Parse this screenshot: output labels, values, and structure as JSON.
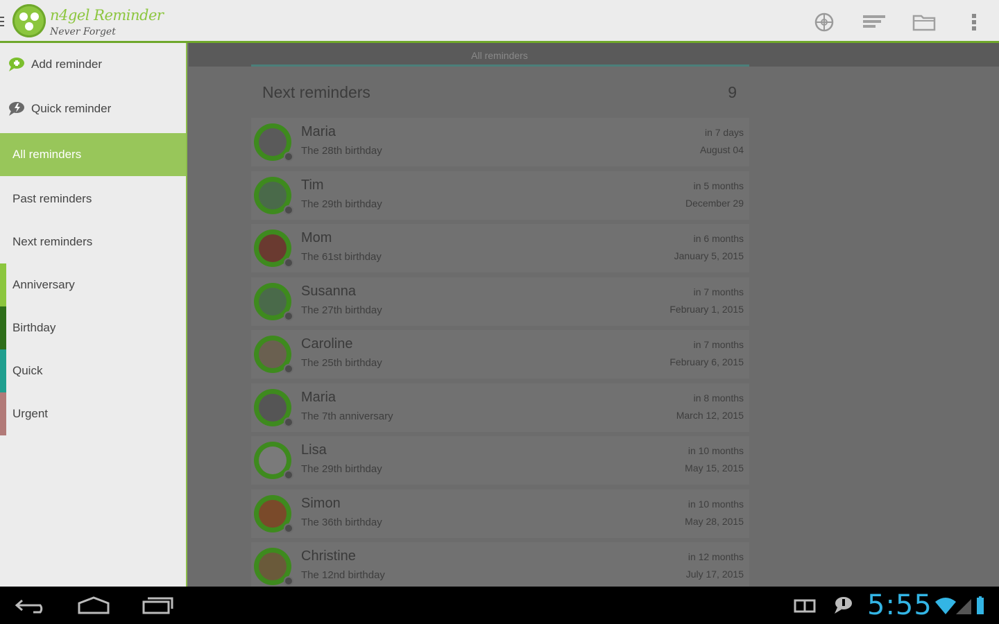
{
  "app": {
    "title": "n4gel Reminder",
    "subtitle": "Never Forget"
  },
  "actionbar": {
    "icons": [
      "compass-icon",
      "sort-icon",
      "folder-icon",
      "overflow-menu-icon"
    ]
  },
  "drawer": {
    "items": [
      {
        "label": "Add reminder",
        "icon": "speech-bubble-add-icon"
      },
      {
        "label": "Quick reminder",
        "icon": "speech-bubble-quick-icon"
      },
      {
        "label": "All reminders",
        "active": true
      },
      {
        "label": "Past reminders"
      },
      {
        "label": "Next reminders"
      },
      {
        "label": "Anniversary",
        "color": "#8cc63e"
      },
      {
        "label": "Birthday",
        "color": "#2e6e1a"
      },
      {
        "label": "Quick",
        "color": "#1f9f8f"
      },
      {
        "label": "Urgent",
        "color": "#b27a78"
      }
    ]
  },
  "content": {
    "tab_label": "All reminders",
    "header_title": "Next reminders",
    "header_count": "9",
    "reminders": [
      {
        "name": "Maria",
        "description": "The 28th birthday",
        "relative": "in 7 days",
        "date": "August 04",
        "avatar_color": "#5a5a5a"
      },
      {
        "name": "Tim",
        "description": "The 29th birthday",
        "relative": "in 5 months",
        "date": "December 29",
        "avatar_color": "#4a6a4a"
      },
      {
        "name": "Mom",
        "description": "The 61st birthday",
        "relative": "in 6 months",
        "date": "January 5, 2015",
        "avatar_color": "#6a3a30"
      },
      {
        "name": "Susanna",
        "description": "The 27th birthday",
        "relative": "in 7 months",
        "date": "February 1, 2015",
        "avatar_color": "#4a6a4a"
      },
      {
        "name": "Caroline",
        "description": "The 25th birthday",
        "relative": "in 7 months",
        "date": "February 6, 2015",
        "avatar_color": "#6a6050"
      },
      {
        "name": "Maria",
        "description": "The 7th anniversary",
        "relative": "in 8 months",
        "date": "March 12, 2015",
        "avatar_color": "#555555"
      },
      {
        "name": "Lisa",
        "description": "The 29th birthday",
        "relative": "in 10 months",
        "date": "May 15, 2015",
        "avatar_color": "#7a7a7a"
      },
      {
        "name": "Simon",
        "description": "The 36th birthday",
        "relative": "in 10 months",
        "date": "May 28, 2015",
        "avatar_color": "#7a4a2a"
      },
      {
        "name": "Christine",
        "description": "The 12nd birthday",
        "relative": "in 12 months",
        "date": "July 17, 2015",
        "avatar_color": "#6a5a3a"
      }
    ]
  },
  "system_bar": {
    "clock": "5:55",
    "accent": "#33b5e5"
  }
}
